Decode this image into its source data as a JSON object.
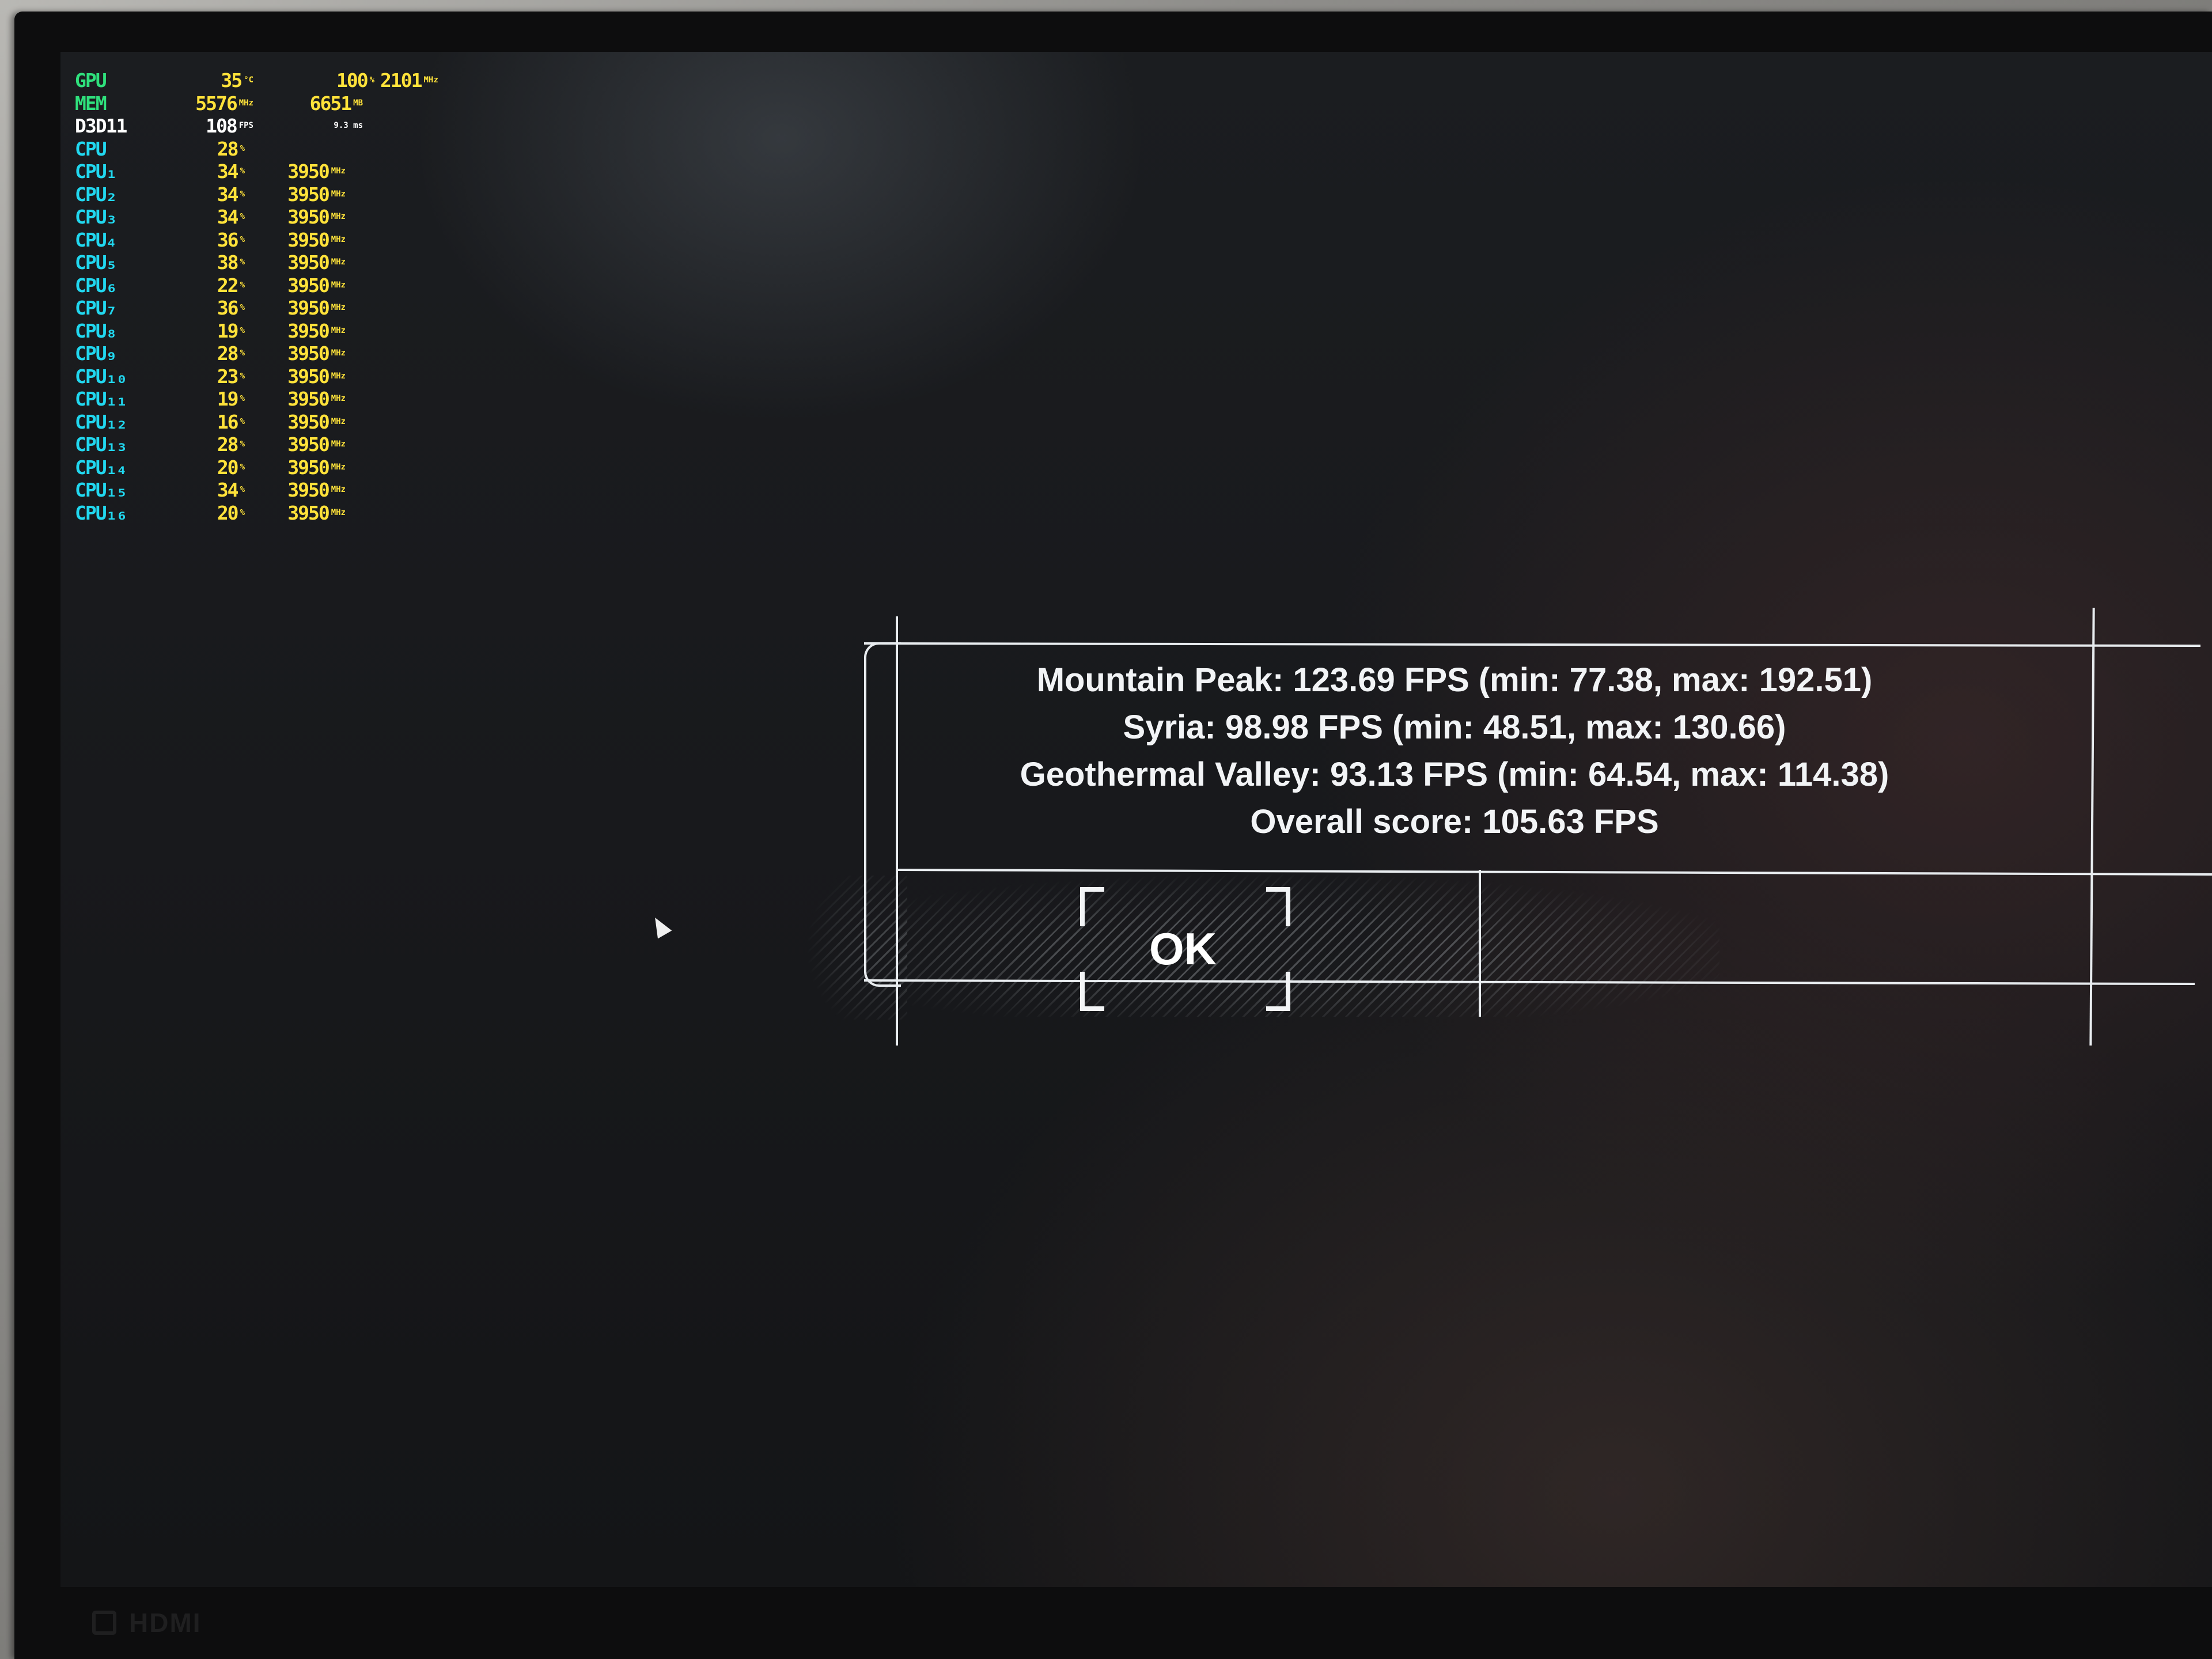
{
  "osd": {
    "gpu": {
      "label": "GPU",
      "temp": "35",
      "temp_unit": "°C",
      "usage": "100",
      "usage_unit": "%",
      "clock": "2101",
      "clock_unit": "MHz"
    },
    "mem": {
      "label": "MEM",
      "clock": "5576",
      "clock_unit": "MHz",
      "used": "6651",
      "used_unit": "MB"
    },
    "api": {
      "label": "D3D11",
      "fps": "108",
      "fps_unit": "FPS",
      "frametime": "9.3 ms"
    },
    "cpu": {
      "label": "CPU",
      "usage": "28",
      "usage_unit": "%"
    },
    "cores": [
      {
        "label": "CPU₁",
        "usage": "34",
        "clock": "3950"
      },
      {
        "label": "CPU₂",
        "usage": "34",
        "clock": "3950"
      },
      {
        "label": "CPU₃",
        "usage": "34",
        "clock": "3950"
      },
      {
        "label": "CPU₄",
        "usage": "36",
        "clock": "3950"
      },
      {
        "label": "CPU₅",
        "usage": "38",
        "clock": "3950"
      },
      {
        "label": "CPU₆",
        "usage": "22",
        "clock": "3950"
      },
      {
        "label": "CPU₇",
        "usage": "36",
        "clock": "3950"
      },
      {
        "label": "CPU₈",
        "usage": "19",
        "clock": "3950"
      },
      {
        "label": "CPU₉",
        "usage": "28",
        "clock": "3950"
      },
      {
        "label": "CPU₁₀",
        "usage": "23",
        "clock": "3950"
      },
      {
        "label": "CPU₁₁",
        "usage": "19",
        "clock": "3950"
      },
      {
        "label": "CPU₁₂",
        "usage": "16",
        "clock": "3950"
      },
      {
        "label": "CPU₁₃",
        "usage": "28",
        "clock": "3950"
      },
      {
        "label": "CPU₁₄",
        "usage": "20",
        "clock": "3950"
      },
      {
        "label": "CPU₁₅",
        "usage": "34",
        "clock": "3950"
      },
      {
        "label": "CPU₁₆",
        "usage": "20",
        "clock": "3950"
      }
    ],
    "core_usage_unit": "%",
    "core_clock_unit": "MHz"
  },
  "results": {
    "lines": [
      "Mountain Peak: 123.69 FPS (min: 77.38, max: 192.51)",
      "Syria: 98.98 FPS (min: 48.51, max: 130.66)",
      "Geothermal Valley: 93.13 FPS (min: 64.54, max: 114.38)",
      "Overall score: 105.63 FPS"
    ],
    "ok_label": "OK"
  },
  "monitor": {
    "input_brand": "HDMI"
  },
  "colors": {
    "osd_gpu_mem": "#2fe07c",
    "osd_cpu": "#21d8f0",
    "osd_value": "#ffe23a",
    "dialog_line": "#e8ecef"
  }
}
